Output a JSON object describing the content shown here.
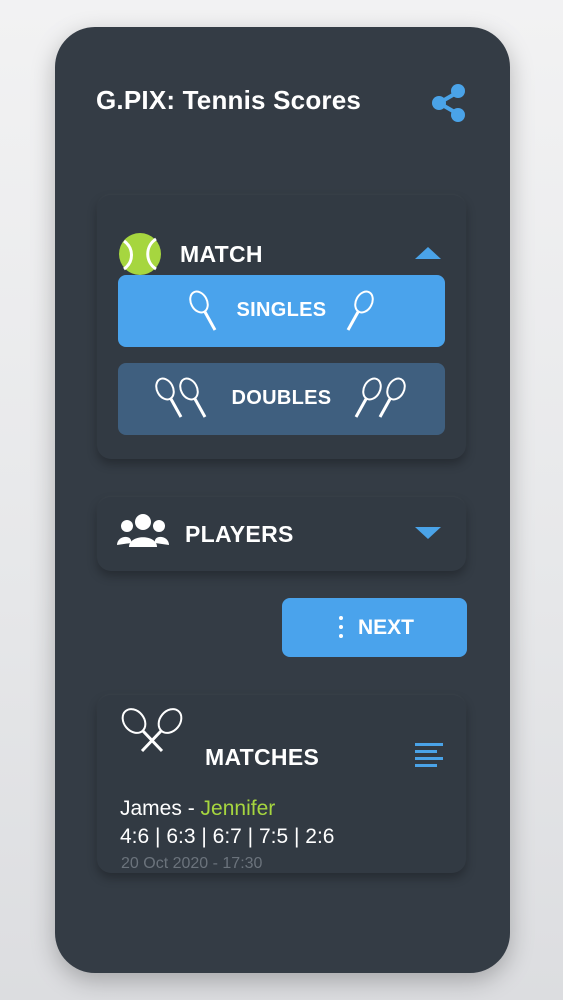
{
  "app": {
    "title": "G.PIX: Tennis Scores",
    "share_icon": "share-icon"
  },
  "match_section": {
    "label": "MATCH",
    "icon": "tennis-ball-icon",
    "expanded": true,
    "buttons": {
      "singles_label": "SINGLES",
      "doubles_label": "DOUBLES"
    }
  },
  "players_section": {
    "label": "PLAYERS",
    "icon": "people-group-icon",
    "expanded": false
  },
  "next_button": {
    "label": "NEXT"
  },
  "matches_section": {
    "label": "MATCHES",
    "icon": "crossed-rackets-icon",
    "list_icon": "list-lines-icon",
    "entries": [
      {
        "player1": "James",
        "separator": " - ",
        "player2": "Jennifer",
        "scores": "4:6 | 6:3 | 6:7 | 7:5 | 2:6",
        "date": "20 Oct 2020 - 17:30"
      }
    ]
  },
  "colors": {
    "background": "#343c45",
    "accent": "#4aa3ec",
    "secondary_button": "#3f5f7f",
    "ball_green": "#a6d63f",
    "muted_text": "#6b737c"
  }
}
